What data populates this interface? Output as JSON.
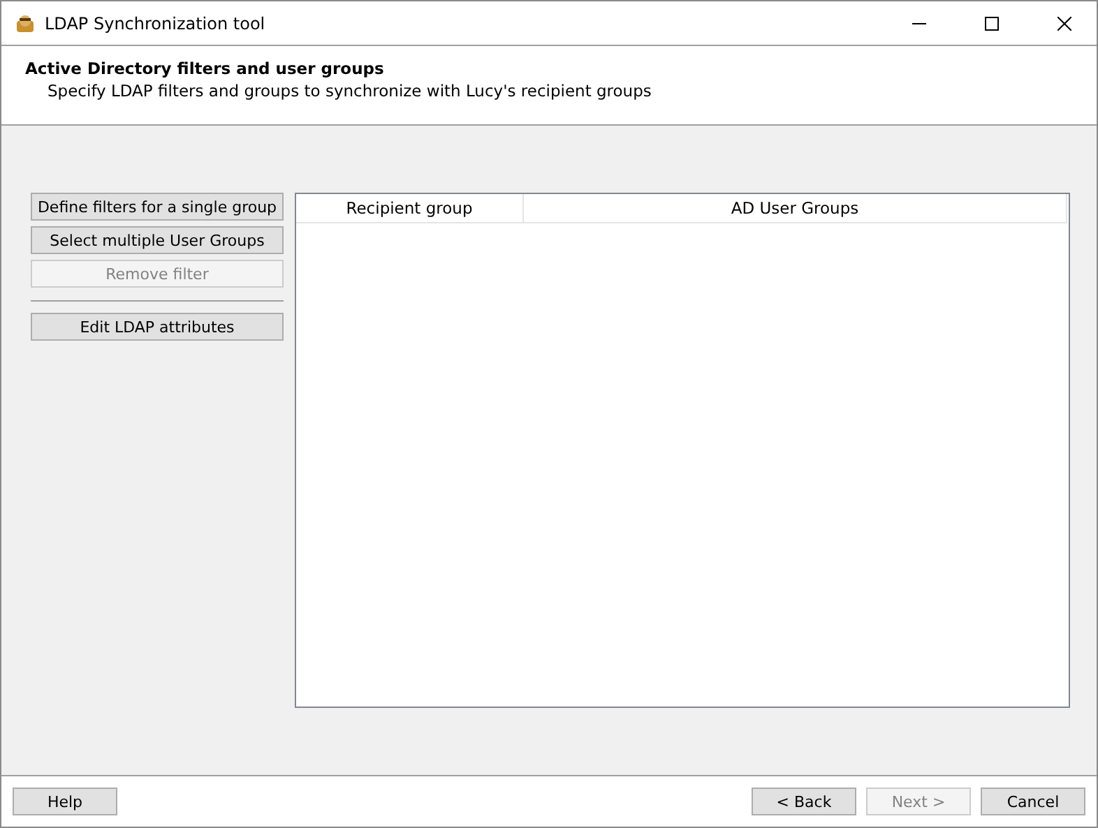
{
  "window": {
    "title": "LDAP Synchronization tool"
  },
  "header": {
    "title": "Active Directory filters and user groups",
    "subtitle": "Specify LDAP filters and groups to synchronize with Lucy's recipient groups"
  },
  "side_buttons": [
    {
      "label": "Define filters for a single group",
      "disabled": false
    },
    {
      "label": "Select multiple User Groups",
      "disabled": false
    },
    {
      "label": "Remove filter",
      "disabled": true
    }
  ],
  "extra_buttons": [
    {
      "label": "Edit LDAP attributes",
      "disabled": false
    }
  ],
  "table": {
    "columns": [
      "Recipient group",
      "AD User Groups"
    ]
  },
  "footer": {
    "left": [
      {
        "label": "Help",
        "disabled": false
      }
    ],
    "right": [
      {
        "label": "< Back",
        "disabled": false
      },
      {
        "label": "Next >",
        "disabled": true
      },
      {
        "label": "Cancel",
        "disabled": false
      }
    ]
  }
}
